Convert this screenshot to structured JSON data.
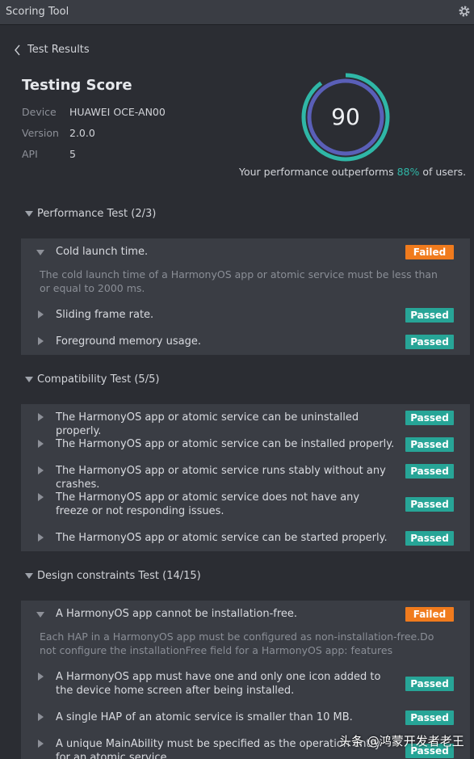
{
  "window": {
    "title": "Scoring Tool"
  },
  "nav": {
    "back_label": "Test Results"
  },
  "score": {
    "title": "Testing Score",
    "device_label": "Device",
    "device_value": "HUAWEI OCE-AN00",
    "version_label": "Version",
    "version_value": "2.0.0",
    "api_label": "API",
    "api_value": "5",
    "value": "90",
    "outperform_prefix": "Your performance outperforms ",
    "outperform_pct": "88%",
    "outperform_suffix": " of users.",
    "accent_color": "#2fb7a7",
    "ring_color": "#5a5fb8"
  },
  "sections": [
    {
      "title": "Performance Test (2/3)",
      "items": [
        {
          "label": "Cold launch time.",
          "status": "Failed",
          "expanded": true,
          "description": "The cold launch time of a HarmonyOS app or atomic service must be less than or equal to 2000 ms."
        },
        {
          "label": "Sliding frame rate.",
          "status": "Passed"
        },
        {
          "label": "Foreground memory usage.",
          "status": "Passed"
        }
      ]
    },
    {
      "title": "Compatibility Test (5/5)",
      "items": [
        {
          "label": "The HarmonyOS app or atomic service can be uninstalled properly.",
          "status": "Passed"
        },
        {
          "label": "The HarmonyOS app or atomic service can be installed properly.",
          "status": "Passed"
        },
        {
          "label": "The HarmonyOS app or atomic service runs stably without any crashes.",
          "status": "Passed"
        },
        {
          "label": "The HarmonyOS app or atomic service does not have any freeze or not responding issues.",
          "status": "Passed"
        },
        {
          "label": "The HarmonyOS app or atomic service can be started properly.",
          "status": "Passed"
        }
      ]
    },
    {
      "title": "Design constraints Test (14/15)",
      "items": [
        {
          "label": "A HarmonyOS app cannot be installation-free.",
          "status": "Failed",
          "expanded": true,
          "description": "Each HAP in a HarmonyOS app must be configured as non-installation-free.Do not configure the installationFree field for a HarmonyOS app: features"
        },
        {
          "label": "A HarmonyOS app must have one and only one icon added to the device home screen after being installed.",
          "status": "Passed"
        },
        {
          "label": "A single HAP of an atomic service is smaller than 10 MB.",
          "status": "Passed"
        },
        {
          "label": "A unique MainAbility must be specified as the operation entry for an atomic service.",
          "status": "Passed"
        }
      ]
    }
  ],
  "status_colors": {
    "Passed": "#27a597",
    "Failed": "#f07b1d"
  },
  "watermark": "头条 @鸿蒙开发者老王"
}
